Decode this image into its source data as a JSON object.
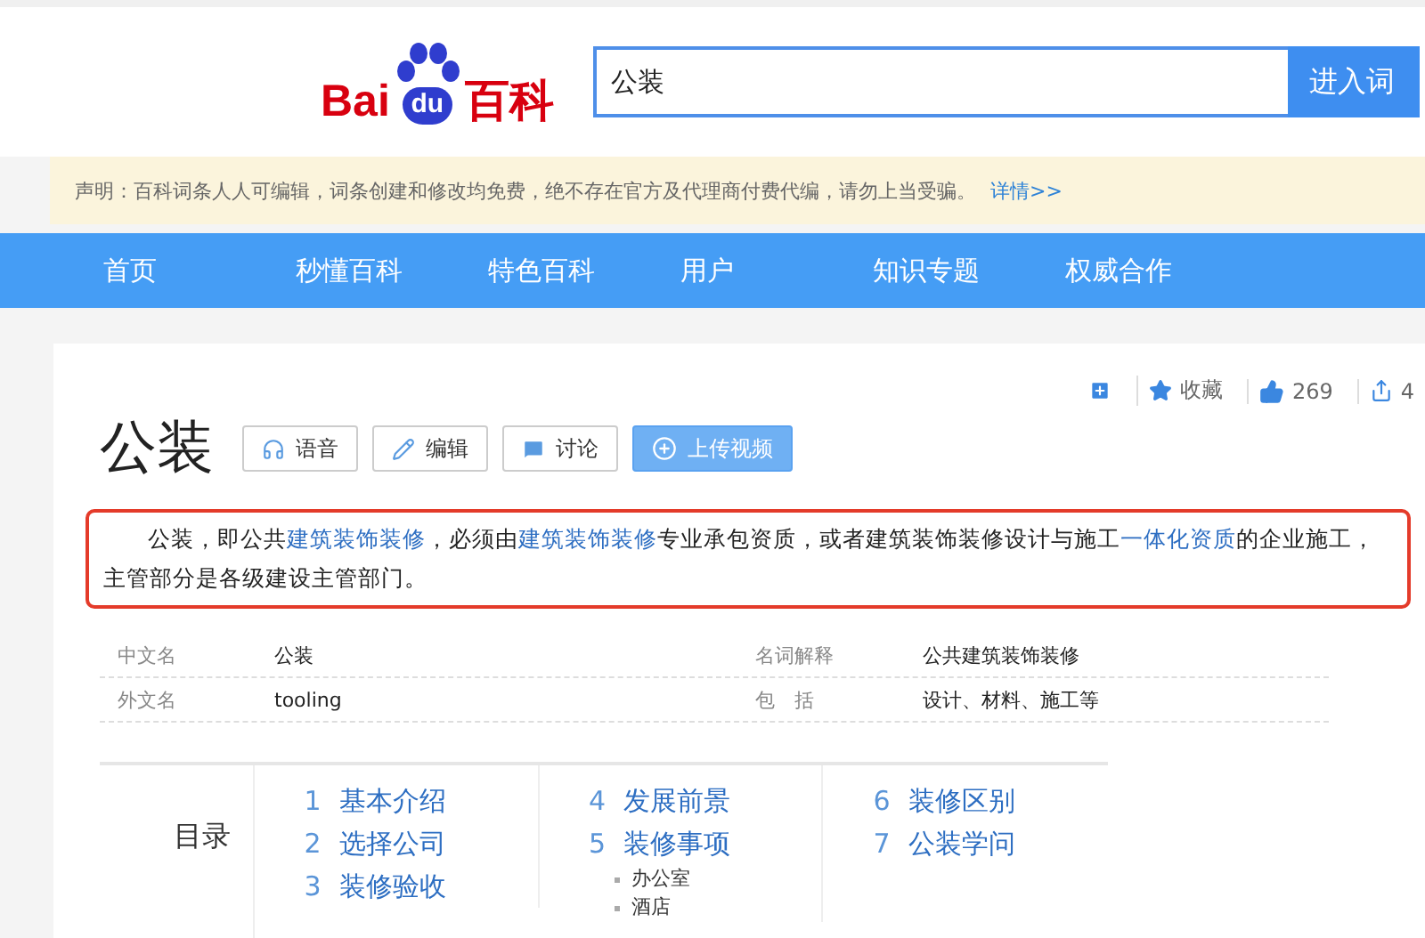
{
  "logo": {
    "parts": [
      "Bai",
      "du",
      "百科"
    ]
  },
  "search": {
    "value": "公装",
    "button": "进入词"
  },
  "notice": {
    "text": "声明：百科词条人人可编辑，词条创建和修改均免费，绝不存在官方及代理商付费代编，请勿上当受骗。",
    "link": "详情>>"
  },
  "nav": [
    {
      "label": "首页"
    },
    {
      "label": "秒懂百科"
    },
    {
      "label": "特色百科"
    },
    {
      "label": "用户"
    },
    {
      "label": "知识专题"
    },
    {
      "label": "权威合作"
    }
  ],
  "actions": [
    {
      "kind": "add"
    },
    {
      "kind": "favorite",
      "label": "收藏"
    },
    {
      "kind": "like",
      "label": "269"
    },
    {
      "kind": "share",
      "label": "4"
    }
  ],
  "title": "公装",
  "title_buttons": [
    {
      "kind": "audio",
      "label": "语音",
      "primary": false
    },
    {
      "kind": "edit",
      "label": "编辑",
      "primary": false
    },
    {
      "kind": "discuss",
      "label": "讨论",
      "primary": false
    },
    {
      "kind": "upload",
      "label": "上传视频",
      "primary": true
    }
  ],
  "summary": [
    {
      "text": "公装，即公共",
      "link": false
    },
    {
      "text": "建筑装饰装修",
      "link": true
    },
    {
      "text": "，必须由",
      "link": false
    },
    {
      "text": "建筑装饰装修",
      "link": true
    },
    {
      "text": "专业承包资质，或者建筑装饰装修设计与施工",
      "link": false
    },
    {
      "text": "一体化资质",
      "link": true
    },
    {
      "text": "的企业施工，主管部分是各级建设主管部门。",
      "link": false
    }
  ],
  "info": [
    [
      {
        "label": "中文名",
        "value": "公装"
      },
      {
        "label": "名词解释",
        "value": "公共建筑装饰装修"
      }
    ],
    [
      {
        "label": "外文名",
        "value": "tooling"
      },
      {
        "label": "包　括",
        "value": "设计、材料、施工等"
      }
    ]
  ],
  "catalog": {
    "title": "目录",
    "columns": [
      [
        {
          "number": "1",
          "label": "基本介绍"
        },
        {
          "number": "2",
          "label": "选择公司"
        },
        {
          "number": "3",
          "label": "装修验收"
        }
      ],
      [
        {
          "number": "4",
          "label": "发展前景"
        },
        {
          "number": "5",
          "label": "装修事项",
          "children": [
            {
              "label": "办公室"
            },
            {
              "label": "酒店"
            }
          ]
        }
      ],
      [
        {
          "number": "6",
          "label": "装修区别"
        },
        {
          "number": "7",
          "label": "公装学问"
        }
      ]
    ]
  }
}
